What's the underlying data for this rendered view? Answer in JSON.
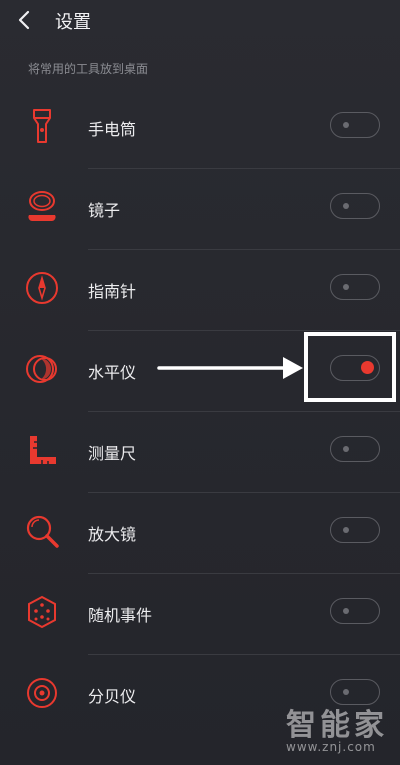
{
  "header": {
    "title": "设置"
  },
  "section": {
    "label": "将常用的工具放到桌面"
  },
  "items": [
    {
      "label": "手电筒",
      "icon": "flashlight-icon",
      "enabled": false
    },
    {
      "label": "镜子",
      "icon": "mirror-icon",
      "enabled": false
    },
    {
      "label": "指南针",
      "icon": "compass-icon",
      "enabled": false
    },
    {
      "label": "水平仪",
      "icon": "level-icon",
      "enabled": true
    },
    {
      "label": "测量尺",
      "icon": "ruler-icon",
      "enabled": false
    },
    {
      "label": "放大镜",
      "icon": "magnifier-icon",
      "enabled": false
    },
    {
      "label": "随机事件",
      "icon": "dice-icon",
      "enabled": false
    },
    {
      "label": "分贝仪",
      "icon": "decibel-icon",
      "enabled": false
    }
  ],
  "watermark": {
    "logo": "智能家",
    "url": "www.znj.com"
  },
  "colors": {
    "accent": "#e8392f",
    "background": "#26272d",
    "highlight": "#ffffff"
  }
}
